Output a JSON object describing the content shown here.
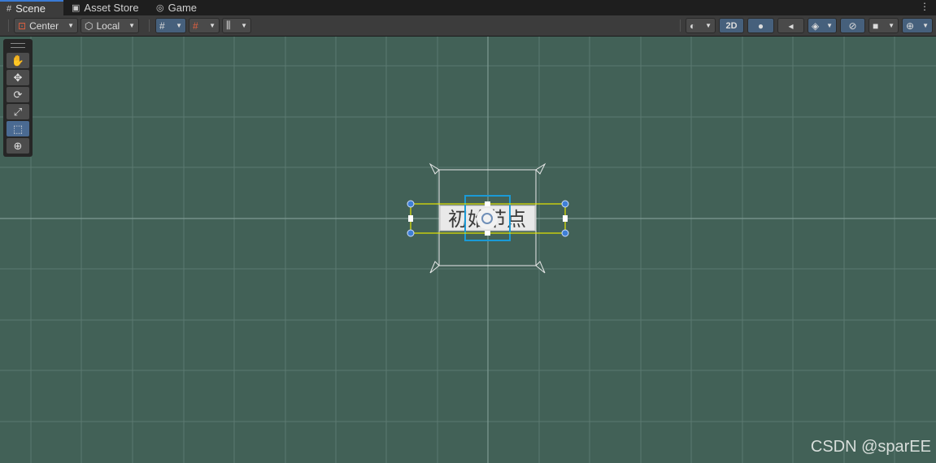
{
  "tabs": [
    {
      "label": "Scene",
      "icon": "grid-icon",
      "active": true
    },
    {
      "label": "Asset Store",
      "icon": "bag-icon",
      "active": false
    },
    {
      "label": "Game",
      "icon": "gamepad-icon",
      "active": false
    }
  ],
  "toolbar": {
    "pivot_mode": "Center",
    "pivot_rotation": "Local",
    "view_2d_label": "2D"
  },
  "tools": [
    {
      "name": "hand-tool",
      "icon": "hand-icon",
      "glyph": "✋"
    },
    {
      "name": "move-tool",
      "icon": "move-icon",
      "glyph": "✥"
    },
    {
      "name": "rotate-tool",
      "icon": "rotate-icon",
      "glyph": "⟳"
    },
    {
      "name": "scale-tool",
      "icon": "scale-icon",
      "glyph": "⤢"
    },
    {
      "name": "rect-tool",
      "icon": "rect-icon",
      "glyph": "⬚",
      "active": true
    },
    {
      "name": "transform-tool",
      "icon": "transform-icon",
      "glyph": "⊕"
    }
  ],
  "scene": {
    "label_text": "初始节点",
    "background_color": "#426157",
    "selection_color": "#e6e600",
    "highlight_color": "#1a9ad6"
  },
  "watermark": "CSDN @sparEE"
}
